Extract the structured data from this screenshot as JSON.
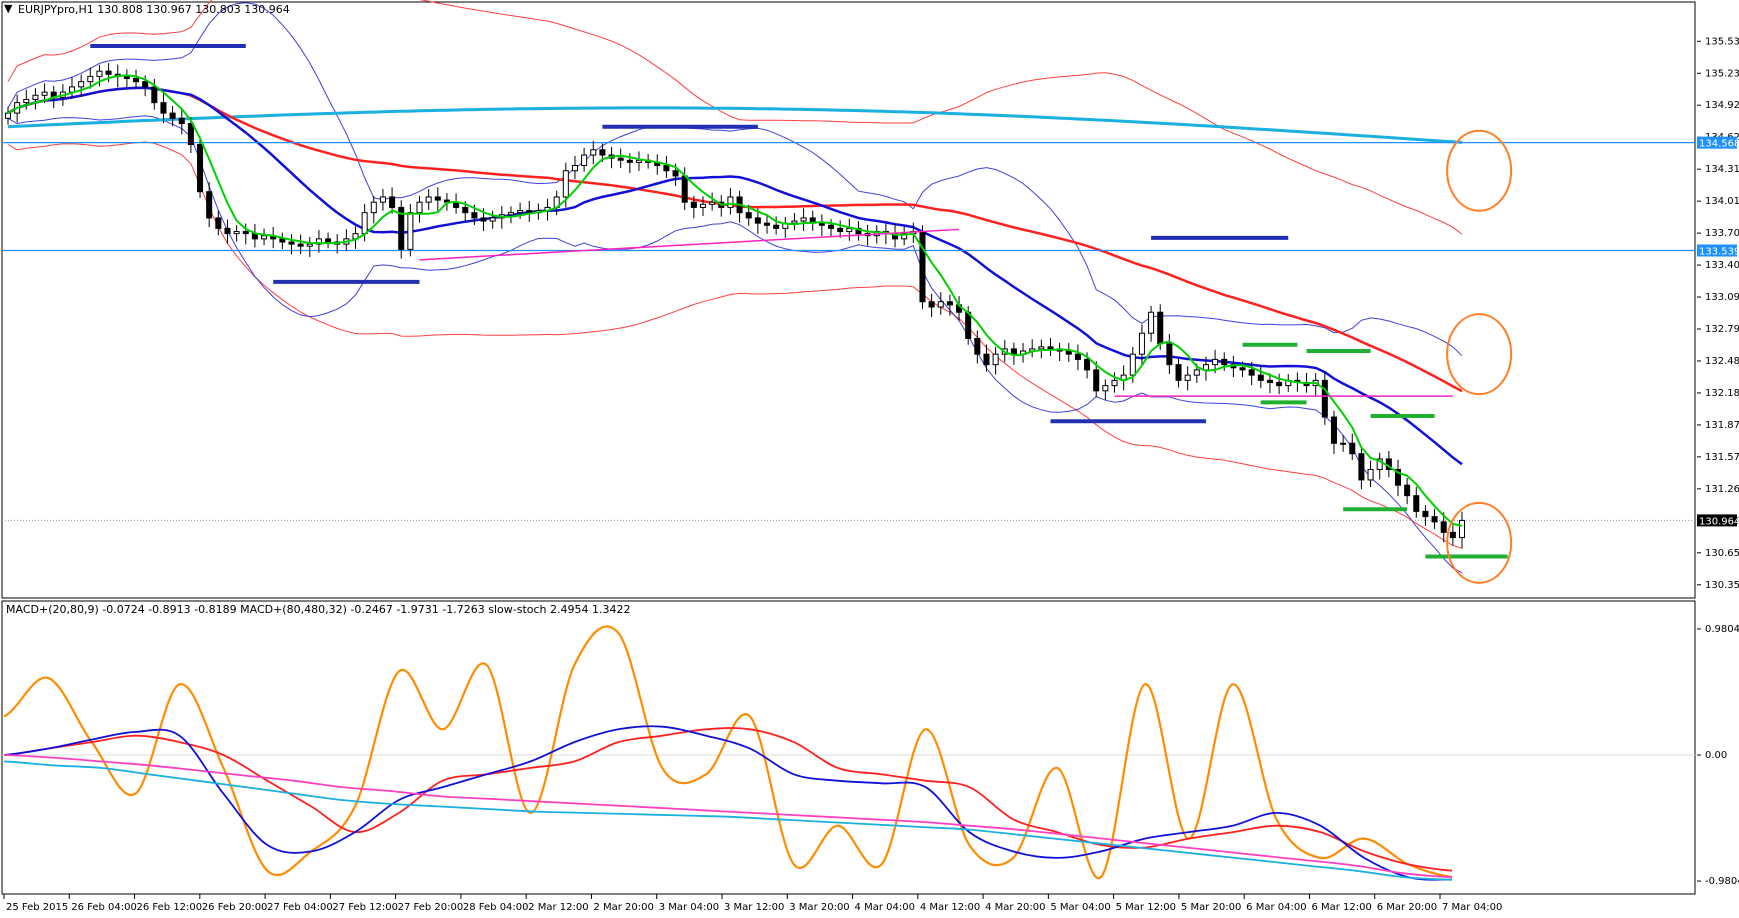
{
  "window": {
    "symbol_header": "EURJPYpro,H1  130.808 130.967 130.803 130.964",
    "collapse_arrow": "▼"
  },
  "indicator_header": "MACD+(20,80,9) -0.0724 -0.8913 -0.8189  MACD+(80,480,32) -0.2467 -1.9731 -1.7263  slow-stoch 2.4954 1.3422",
  "chart_data": [
    {
      "type": "candlestick",
      "symbol": "EURJPYpro",
      "timeframe": "H1",
      "ohlc_last": {
        "open": 130.808,
        "high": 130.967,
        "low": 130.803,
        "close": 130.964
      },
      "ylim": [
        130.3,
        135.7
      ],
      "y_ticks": [
        "135.535",
        "135.230",
        "134.925",
        "134.620",
        "134.315",
        "134.010",
        "133.705",
        "133.400",
        "133.095",
        "132.790",
        "132.485",
        "132.180",
        "131.875",
        "131.570",
        "131.265",
        "130.960",
        "130.655",
        "130.350"
      ],
      "x_ticks": [
        "25 Feb 2015",
        "26 Feb 04:00",
        "26 Feb 12:00",
        "26 Feb 20:00",
        "27 Feb 04:00",
        "27 Feb 12:00",
        "27 Feb 20:00",
        "28 Feb 04:00",
        "2 Mar 12:00",
        "2 Mar 20:00",
        "3 Mar 04:00",
        "3 Mar 12:00",
        "3 Mar 20:00",
        "4 Mar 04:00",
        "4 Mar 12:00",
        "4 Mar 20:00",
        "5 Mar 04:00",
        "5 Mar 12:00",
        "5 Mar 20:00",
        "6 Mar 04:00",
        "6 Mar 12:00",
        "6 Mar 20:00",
        "7 Mar 04:00"
      ],
      "price_labels": {
        "current": "130.964",
        "level_1": "134.568",
        "level_2": "133.539"
      },
      "horizontal_levels": [
        134.568,
        133.539
      ],
      "closes": [
        134.85,
        134.95,
        134.98,
        135.02,
        135.05,
        135.0,
        135.05,
        135.1,
        135.15,
        135.2,
        135.25,
        135.22,
        135.2,
        135.18,
        135.15,
        135.1,
        134.95,
        134.85,
        134.8,
        134.75,
        134.55,
        134.1,
        133.85,
        133.75,
        133.7,
        133.72,
        133.7,
        133.65,
        133.68,
        133.65,
        133.62,
        133.6,
        133.58,
        133.6,
        133.65,
        133.62,
        133.6,
        133.65,
        133.7,
        133.9,
        134.0,
        134.05,
        133.95,
        133.55,
        133.9,
        134.0,
        134.05,
        134.02,
        134.0,
        133.95,
        133.9,
        133.85,
        133.82,
        133.85,
        133.88,
        133.9,
        133.92,
        133.9,
        133.92,
        133.95,
        134.05,
        134.3,
        134.35,
        134.45,
        134.5,
        134.45,
        134.42,
        134.4,
        134.38,
        134.4,
        134.38,
        134.35,
        134.3,
        134.25,
        134.0,
        133.95,
        133.98,
        134.0,
        133.95,
        134.05,
        133.9,
        133.85,
        133.8,
        133.78,
        133.75,
        133.8,
        133.82,
        133.85,
        133.8,
        133.78,
        133.75,
        133.72,
        133.75,
        133.7,
        133.68,
        133.72,
        133.7,
        133.65,
        133.7,
        133.72,
        133.05,
        133.0,
        133.05,
        133.02,
        132.95,
        132.7,
        132.55,
        132.45,
        132.55,
        132.6,
        132.55,
        132.58,
        132.6,
        132.62,
        132.6,
        132.58,
        132.55,
        132.5,
        132.4,
        132.2,
        132.25,
        132.3,
        132.35,
        132.55,
        132.75,
        132.95,
        132.65,
        132.45,
        132.3,
        132.35,
        132.4,
        132.45,
        132.5,
        132.45,
        132.42,
        132.4,
        132.35,
        132.3,
        132.28,
        132.25,
        132.3,
        132.28,
        132.25,
        132.3,
        131.95,
        131.7,
        131.7,
        131.6,
        131.35,
        131.45,
        131.55,
        131.45,
        131.3,
        131.2,
        131.05,
        131.0,
        130.95,
        130.85,
        130.8,
        130.964
      ],
      "overlays": [
        {
          "name": "",
          "color": "#00d000"
        },
        {
          "name": "",
          "color": "#1010d8"
        },
        {
          "name": "",
          "color": "#ff2020"
        },
        {
          "name": "",
          "color": "#1ab0e0"
        },
        {
          "name": "",
          "color": "#4040e0"
        },
        {
          "name": "",
          "color": "#ff4040"
        }
      ],
      "annotations": {
        "navy_bars": [
          {
            "price": 135.49,
            "from_index": 9,
            "to_index": 26
          },
          {
            "price": 133.24,
            "from_index": 29,
            "to_index": 45
          },
          {
            "price": 134.72,
            "from_index": 65,
            "to_index": 82
          },
          {
            "price": 133.66,
            "from_index": 125,
            "to_index": 140
          },
          {
            "price": 131.91,
            "from_index": 114,
            "to_index": 131
          }
        ],
        "green_bars": [
          {
            "price": 132.64,
            "from_index": 135,
            "to_index": 141
          },
          {
            "price": 132.58,
            "from_index": 142,
            "to_index": 149
          },
          {
            "price": 132.09,
            "from_index": 137,
            "to_index": 142
          },
          {
            "price": 131.96,
            "from_index": 149,
            "to_index": 156
          },
          {
            "price": 131.07,
            "from_index": 146,
            "to_index": 153
          },
          {
            "price": 130.62,
            "from_index": 155,
            "to_index": 164
          }
        ],
        "magenta_lines": [
          {
            "from": [
              45,
              133.45
            ],
            "to": [
              104,
              133.74
            ]
          },
          {
            "from": [
              121,
              132.15
            ],
            "to": [
              158,
              132.15
            ]
          }
        ],
        "orange_circles": [
          {
            "index": 160,
            "price": 134.3
          },
          {
            "index": 160,
            "price": 132.55
          },
          {
            "index": 160,
            "price": 130.75
          }
        ]
      }
    },
    {
      "type": "line",
      "panel": "oscillator",
      "ylim": [
        -1.05,
        1.05
      ],
      "y_ticks": [
        "0.9804",
        "0.00",
        "-0.9804"
      ],
      "series": [
        {
          "name": "",
          "color": "#ff8c00",
          "values": [
            0.3,
            0.6,
            0.1,
            -0.3,
            0.55,
            -0.1,
            -0.9,
            -0.75,
            -0.4,
            0.65,
            0.2,
            0.7,
            -0.45,
            0.7,
            0.95,
            -0.1,
            -0.15,
            0.3,
            -0.85,
            -0.55,
            -0.85,
            0.2,
            -0.7,
            -0.8,
            -0.1,
            -0.95,
            0.55,
            -0.65,
            0.55,
            -0.5,
            -0.8,
            -0.65,
            -0.85,
            -0.95
          ]
        },
        {
          "name": "",
          "color": "#ff2020",
          "values": [
            0.0,
            0.05,
            0.1,
            0.15,
            0.1,
            0.0,
            -0.2,
            -0.4,
            -0.6,
            -0.45,
            -0.2,
            -0.15,
            -0.1,
            -0.05,
            0.1,
            0.15,
            0.2,
            0.2,
            0.1,
            -0.1,
            -0.15,
            -0.2,
            -0.25,
            -0.5,
            -0.6,
            -0.7,
            -0.72,
            -0.65,
            -0.6,
            -0.55,
            -0.6,
            -0.75,
            -0.85,
            -0.9
          ]
        },
        {
          "name": "",
          "color": "#1010d8",
          "values": [
            0.0,
            0.05,
            0.12,
            0.18,
            0.15,
            -0.3,
            -0.7,
            -0.75,
            -0.6,
            -0.35,
            -0.25,
            -0.15,
            -0.05,
            0.1,
            0.2,
            0.22,
            0.15,
            0.05,
            -0.15,
            -0.2,
            -0.22,
            -0.25,
            -0.6,
            -0.75,
            -0.8,
            -0.75,
            -0.65,
            -0.6,
            -0.55,
            -0.45,
            -0.55,
            -0.8,
            -0.95,
            -0.97
          ]
        },
        {
          "name": "",
          "color": "#1ab0e0",
          "values": [
            -0.05,
            -0.08,
            -0.1,
            -0.15,
            -0.2,
            -0.25,
            -0.3,
            -0.35,
            -0.38,
            -0.4,
            -0.42,
            -0.44,
            -0.45,
            -0.46,
            -0.47,
            -0.48,
            -0.5,
            -0.52,
            -0.54,
            -0.56,
            -0.58,
            -0.62,
            -0.66,
            -0.7,
            -0.74,
            -0.78,
            -0.82,
            -0.86,
            -0.9,
            -0.95,
            -0.97
          ]
        },
        {
          "name": "",
          "color": "#ff40c0",
          "values": [
            0.0,
            -0.02,
            -0.05,
            -0.08,
            -0.12,
            -0.16,
            -0.2,
            -0.25,
            -0.28,
            -0.32,
            -0.34,
            -0.36,
            -0.38,
            -0.4,
            -0.42,
            -0.44,
            -0.46,
            -0.48,
            -0.5,
            -0.52,
            -0.55,
            -0.58,
            -0.62,
            -0.66,
            -0.7,
            -0.74,
            -0.78,
            -0.82,
            -0.86,
            -0.92,
            -0.95
          ]
        }
      ]
    }
  ]
}
